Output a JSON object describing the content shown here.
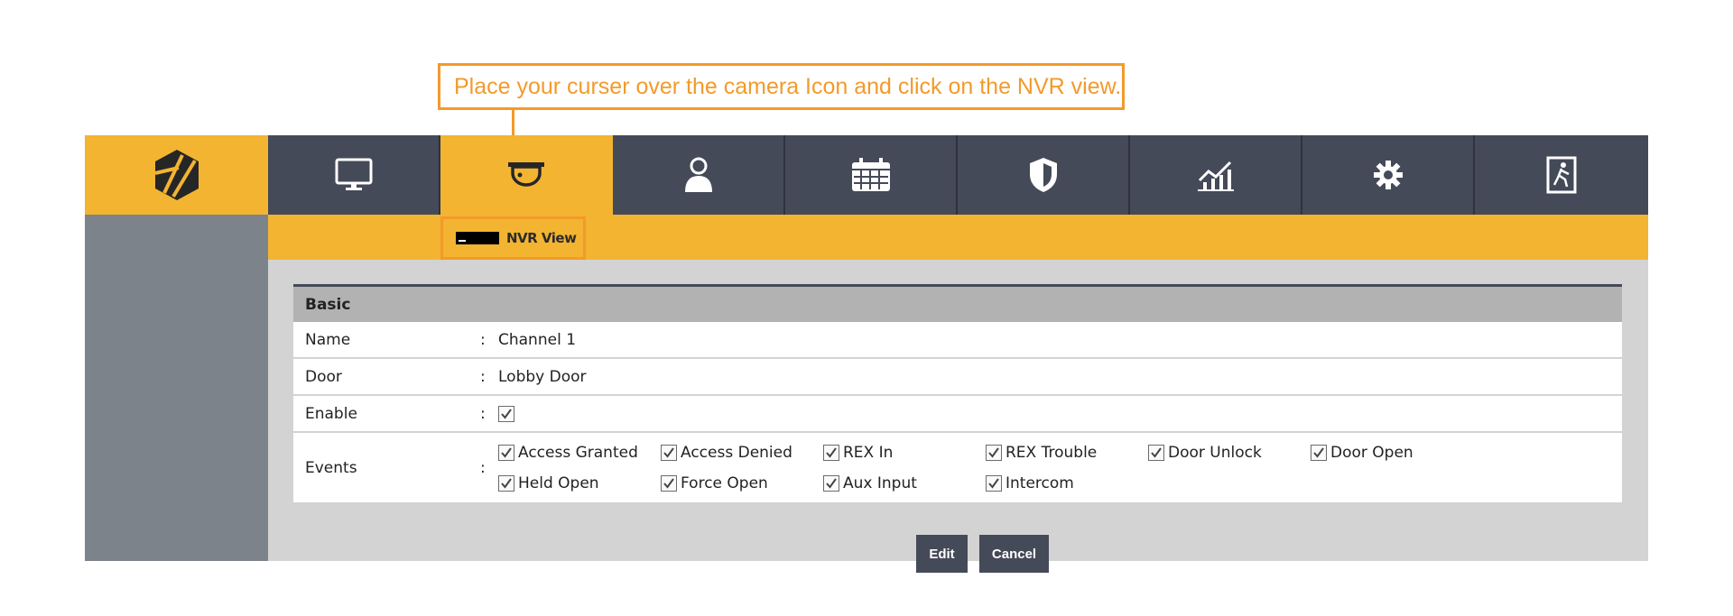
{
  "callout": {
    "text": "Place your curser over the camera Icon and click on the NVR view."
  },
  "nav": {
    "items": [
      {
        "icon": "monitor-icon",
        "active": false
      },
      {
        "icon": "camera-icon",
        "active": true
      },
      {
        "icon": "user-icon",
        "active": false
      },
      {
        "icon": "calendar-icon",
        "active": false
      },
      {
        "icon": "shield-icon",
        "active": false
      },
      {
        "icon": "chart-icon",
        "active": false
      },
      {
        "icon": "gear-icon",
        "active": false
      },
      {
        "icon": "exit-door-icon",
        "active": false
      }
    ]
  },
  "submenu": {
    "nvr_view_label": "NVR View"
  },
  "panel": {
    "title": "Basic",
    "name_label": "Name",
    "name_value": "Channel 1",
    "door_label": "Door",
    "door_value": "Lobby Door",
    "enable_label": "Enable",
    "enable_checked": true,
    "events_label": "Events",
    "colon": ":",
    "events": [
      {
        "label": "Access Granted",
        "checked": true
      },
      {
        "label": "Access Denied",
        "checked": true
      },
      {
        "label": "REX In",
        "checked": true
      },
      {
        "label": "REX Trouble",
        "checked": true
      },
      {
        "label": "Door Unlock",
        "checked": true
      },
      {
        "label": "Door Open",
        "checked": true
      },
      {
        "label": "Held Open",
        "checked": true
      },
      {
        "label": "Force Open",
        "checked": true
      },
      {
        "label": "Aux Input",
        "checked": true
      },
      {
        "label": "Intercom",
        "checked": true
      }
    ]
  },
  "buttons": {
    "edit": "Edit",
    "cancel": "Cancel"
  },
  "colors": {
    "accent": "#f3b431",
    "nav": "#454a58",
    "callout": "#f39a2a",
    "sidebar": "#7c838a"
  }
}
